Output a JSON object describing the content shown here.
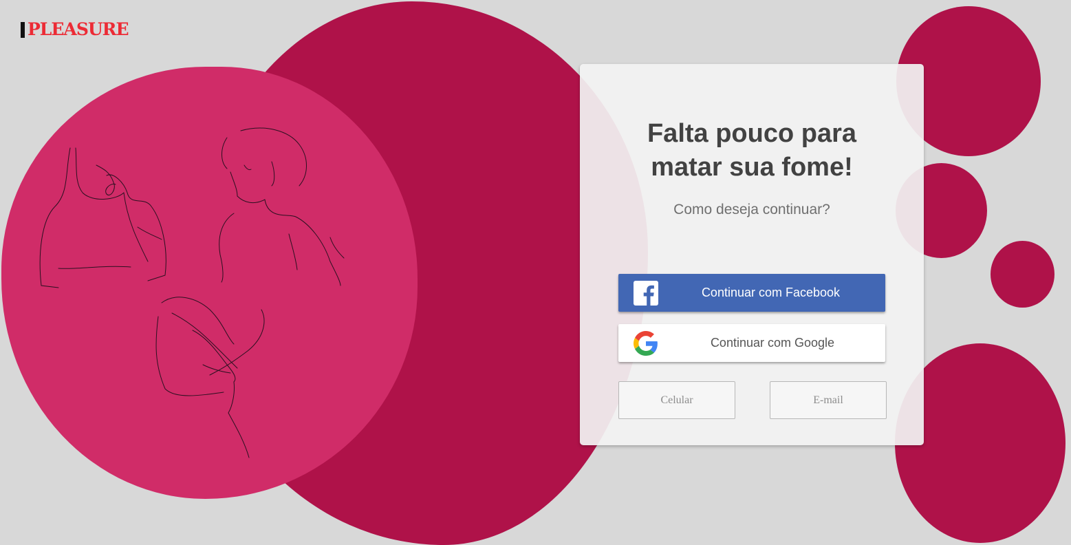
{
  "brand": {
    "logo_text": "PLEASURE"
  },
  "card": {
    "title_line1": "Falta pouco para",
    "title_line2": "matar sua fome!",
    "subtitle": "Como deseja continuar?",
    "facebook_label": "Continuar com Facebook",
    "google_label": "Continuar com Google",
    "phone_label": "Celular",
    "email_label": "E-mail"
  },
  "colors": {
    "background": "#d8d8d8",
    "dark_magenta": "#af1249",
    "pink": "#d02c68",
    "facebook_blue": "#4267b4",
    "logo_red": "#ec2b35"
  },
  "icons": {
    "facebook": "facebook-icon",
    "google": "google-icon"
  }
}
